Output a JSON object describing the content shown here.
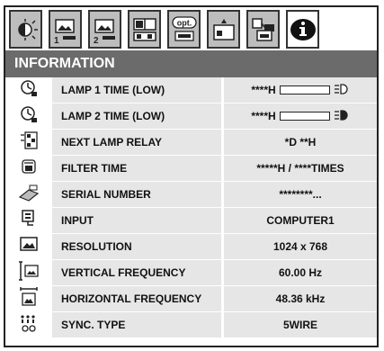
{
  "tabs": [
    {
      "icon": "image-adjust-icon",
      "active": false
    },
    {
      "icon": "picture-1-icon",
      "number": "1",
      "active": false
    },
    {
      "icon": "picture-2-icon",
      "number": "2",
      "active": false
    },
    {
      "icon": "screen-layout-icon",
      "active": false
    },
    {
      "icon": "options-icon",
      "label": "opt.",
      "active": false
    },
    {
      "icon": "installation-icon",
      "active": false
    },
    {
      "icon": "network-icon",
      "active": false
    },
    {
      "icon": "info-icon",
      "active": true
    }
  ],
  "title": "INFORMATION",
  "rows": [
    {
      "icon": "lamp-time-icon",
      "label": "LAMP 1 TIME (LOW)",
      "value": "****H",
      "lamp_indicator": "lamp-outline-icon"
    },
    {
      "icon": "lamp-time-icon",
      "label": "LAMP 2 TIME (LOW)",
      "value": "****H",
      "lamp_indicator": "lamp-filled-icon"
    },
    {
      "icon": "lamp-relay-icon",
      "label": "NEXT LAMP RELAY",
      "value": "*D **H"
    },
    {
      "icon": "filter-icon",
      "label": "FILTER TIME",
      "value": "*****H / ****TIMES"
    },
    {
      "icon": "serial-number-icon",
      "label": "SERIAL NUMBER",
      "value": "********..."
    },
    {
      "icon": "input-icon",
      "label": "INPUT",
      "value": "COMPUTER1"
    },
    {
      "icon": "resolution-icon",
      "label": "RESOLUTION",
      "value": "1024 x 768"
    },
    {
      "icon": "vertical-frequency-icon",
      "label": "VERTICAL FREQUENCY",
      "value": "60.00 Hz"
    },
    {
      "icon": "horizontal-frequency-icon",
      "label": "HORIZONTAL FREQUENCY",
      "value": "48.36 kHz"
    },
    {
      "icon": "sync-type-icon",
      "label": "SYNC. TYPE",
      "value": "5WIRE"
    }
  ]
}
